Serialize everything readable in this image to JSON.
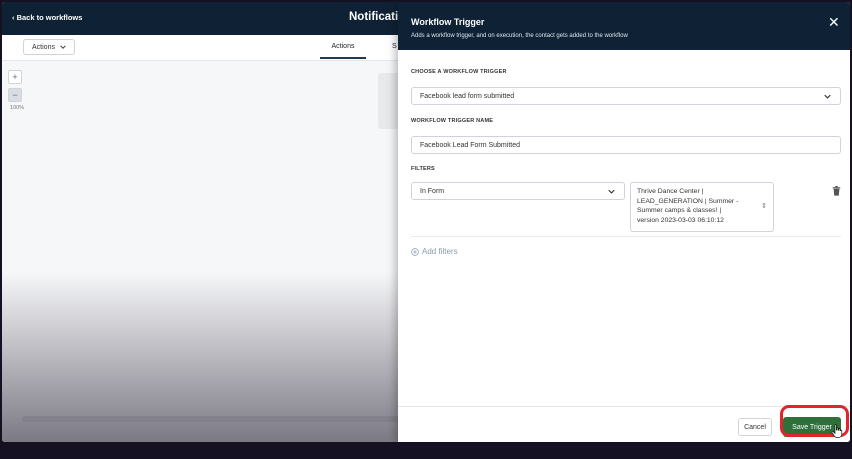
{
  "topbar": {
    "back_label": "Back to workflows",
    "workflow_title": "Notificatic"
  },
  "subbar": {
    "actions_label": "Actions",
    "tab_actions": "Actions",
    "tab_partial": "S"
  },
  "canvas": {
    "zoom_in": "+",
    "zoom_out": "−",
    "zoom_level": "100%"
  },
  "panel": {
    "title": "Workflow Trigger",
    "subtitle": "Adds a workflow trigger, and on execution, the contact gets added to the workflow",
    "close_icon": "close-icon",
    "choose_label": "CHOOSE A WORKFLOW TRIGGER",
    "trigger_value": "Facebook lead form submitted",
    "name_label": "WORKFLOW TRIGGER NAME",
    "name_value": "Facebook Lead Form Submitted",
    "filters_label": "FILTERS",
    "filter_field": "In Form",
    "filter_value_lines": [
      "Thrive Dance Center |",
      "LEAD_GENERATION | Summer -",
      "Summer camps & classes! |",
      "version 2023-03-03 06:10:12"
    ],
    "add_filters": "Add filters",
    "cancel_label": "Cancel",
    "save_label": "Save Trigger"
  },
  "colors": {
    "header_bg": "#0f2235",
    "save_bg": "#2f6f3a",
    "highlight": "#e0262d"
  }
}
